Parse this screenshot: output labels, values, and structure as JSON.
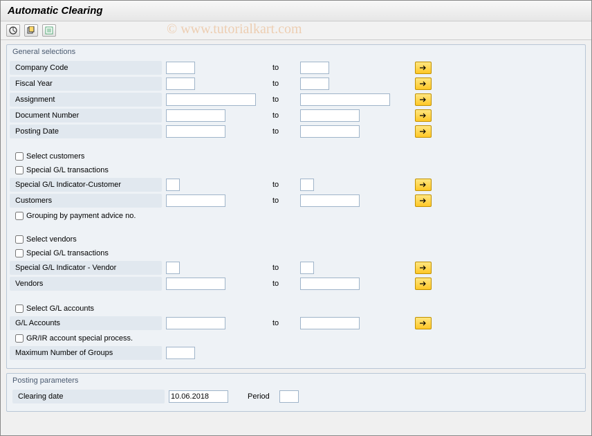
{
  "title": "Automatic Clearing",
  "watermark": "© www.tutorialkart.com",
  "groups": {
    "general": {
      "title": "General selections",
      "company_code": "Company Code",
      "fiscal_year": "Fiscal Year",
      "assignment": "Assignment",
      "document_number": "Document Number",
      "posting_date": "Posting Date",
      "to": "to",
      "select_customers": "Select customers",
      "spec_gl_trans_c": "Special G/L transactions",
      "spec_gl_ind_cust": "Special G/L Indicator-Customer",
      "customers": "Customers",
      "grouping_advice": "Grouping by payment advice no.",
      "select_vendors": "Select vendors",
      "spec_gl_trans_v": "Special G/L transactions",
      "spec_gl_ind_vend": "Special G/L Indicator - Vendor",
      "vendors": "Vendors",
      "select_gl": "Select G/L accounts",
      "gl_accounts": "G/L Accounts",
      "grir": "GR/IR account special process.",
      "max_groups": "Maximum Number of Groups"
    },
    "posting": {
      "title": "Posting parameters",
      "clearing_date": "Clearing date",
      "clearing_date_value": "10.06.2018",
      "period": "Period"
    }
  }
}
